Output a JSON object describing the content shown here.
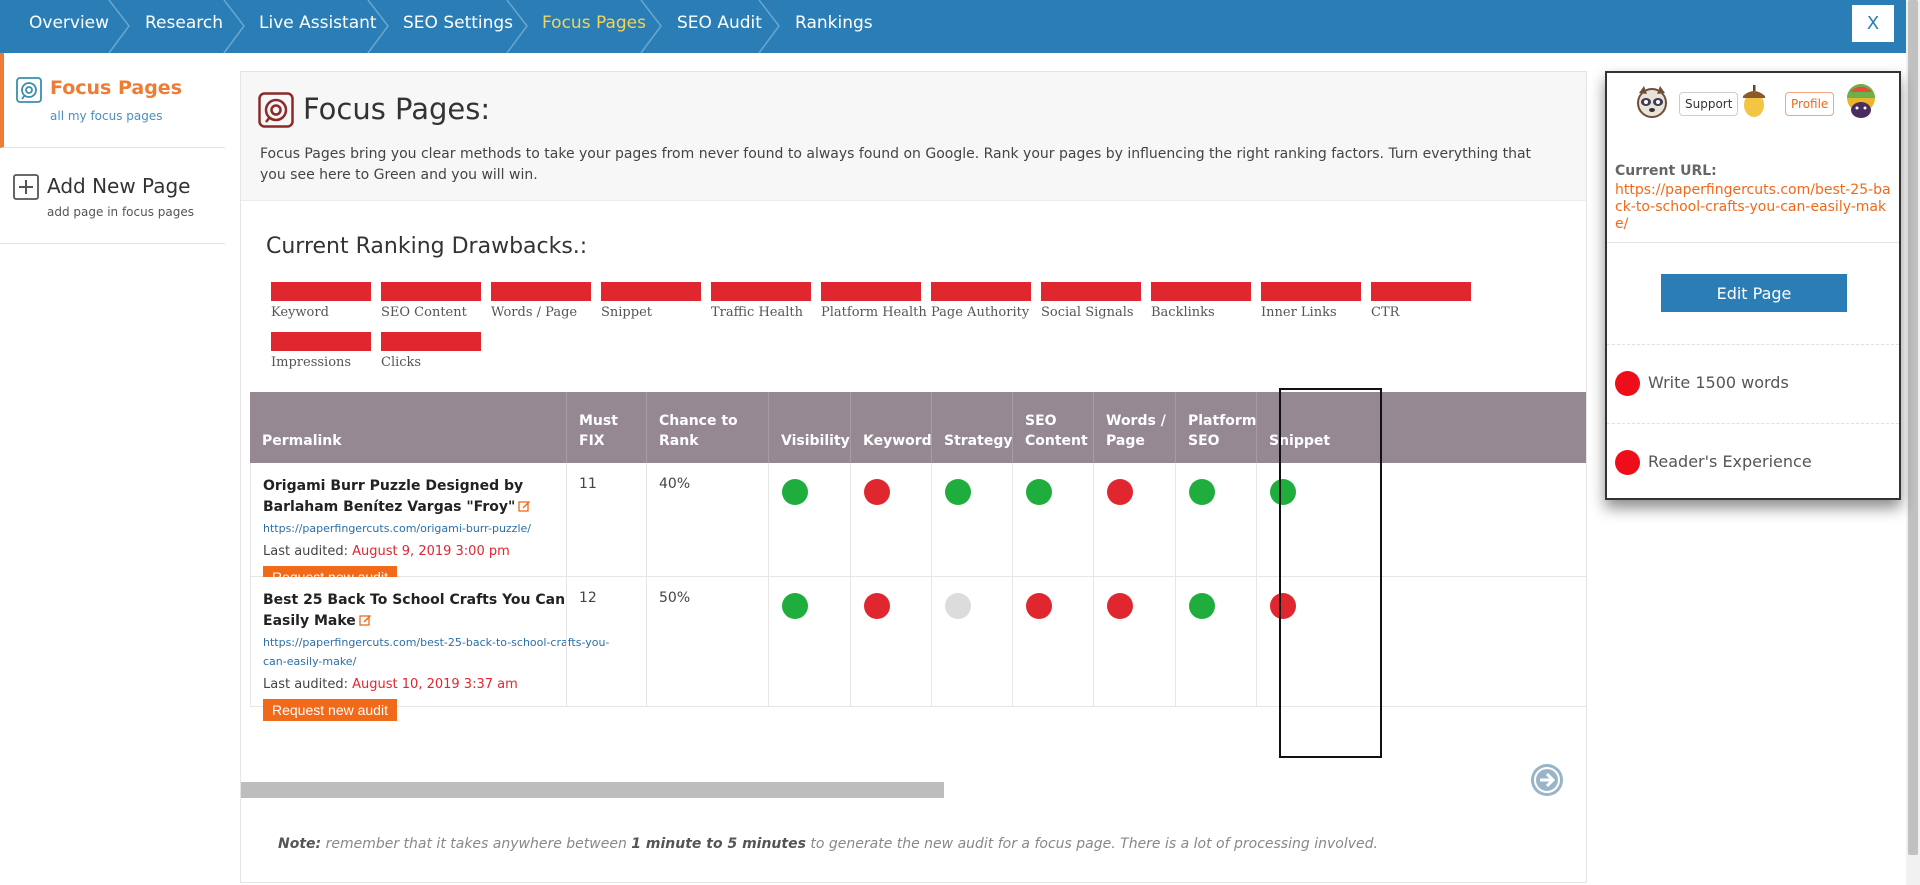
{
  "nav": {
    "items": [
      {
        "label": "Overview",
        "active": false
      },
      {
        "label": "Research",
        "active": false
      },
      {
        "label": "Live Assistant",
        "active": false
      },
      {
        "label": "SEO Settings",
        "active": false
      },
      {
        "label": "Focus Pages",
        "active": true
      },
      {
        "label": "SEO Audit",
        "active": false
      },
      {
        "label": "Rankings",
        "active": false
      }
    ],
    "close_label": "X",
    "bg_color": "#2b7eb5",
    "active_color": "#f5d35b"
  },
  "sidebar": {
    "items": [
      {
        "title": "Focus Pages",
        "subtitle": "all my focus pages",
        "icon": "focus-pages-icon",
        "active": true
      },
      {
        "title": "Add New Page",
        "subtitle": "add page in focus pages",
        "icon": "add-square-icon",
        "active": false
      }
    ]
  },
  "main": {
    "title": "Focus Pages:",
    "intro": "Focus Pages bring you clear methods to take your pages from never found to always found on Google. Rank your pages by influencing the right ranking factors. Turn everything that you see here to Green and you will win.",
    "drawbacks_title": "Current Ranking Drawbacks.:",
    "drawbacks": [
      "Keyword",
      "SEO Content",
      "Words / Page",
      "Snippet",
      "Traffic Health",
      "Platform Health",
      "Page Authority",
      "Social Signals",
      "Backlinks",
      "Inner Links",
      "CTR",
      "Impressions",
      "Clicks"
    ],
    "drawback_color": "#e0262e",
    "table": {
      "headers": [
        "Permalink",
        "Must FIX",
        "Chance to Rank",
        "Visibility",
        "Keyword",
        "Strategy",
        "SEO Content",
        "Words / Page",
        "Platform SEO",
        "Snippet"
      ],
      "rows": [
        {
          "title": "Origami Burr Puzzle Designed by Barlaham Benítez Vargas \"Froy\"",
          "url": "https://paperfingercuts.com/origami-burr-puzzle/",
          "audited_label": "Last audited:",
          "audited_date": "August 9, 2019 3:00 pm",
          "button": "Request new audit",
          "must_fix": "11",
          "chance": "40%",
          "statuses": [
            "green",
            "red",
            "green",
            "green",
            "red",
            "green",
            "green"
          ]
        },
        {
          "title": "Best 25 Back To School Crafts You Can Easily Make",
          "url": "https://paperfingercuts.com/best-25-back-to-school-crafts-you-can-easily-make/",
          "audited_label": "Last audited:",
          "audited_date": "August 10, 2019 3:37 am",
          "button": "Request new audit",
          "must_fix": "12",
          "chance": "50%",
          "statuses": [
            "green",
            "red",
            "grey",
            "red",
            "red",
            "green",
            "red"
          ]
        }
      ],
      "status_colors": {
        "green": "#1fae3e",
        "red": "#e0262e",
        "grey": "#dcdcdc"
      },
      "highlighted_column": "Words / Page"
    },
    "note": {
      "label": "Note:",
      "text_before": "remember that it takes anywhere between",
      "emphasis": "1 minute to 5 minutes",
      "text_after": "to generate the new audit for a focus page. There is a lot of processing involved."
    }
  },
  "right_panel": {
    "support_label": "Support",
    "profile_label": "Profile",
    "current_url_label": "Current URL:",
    "current_url": "https://paperfingercuts.com/best-25-back-to-school-crafts-you-can-easily-make/",
    "edit_button": "Edit Page",
    "tasks": [
      "Write 1500 words",
      "Reader's Experience"
    ],
    "task_color": "#ee0d18"
  }
}
